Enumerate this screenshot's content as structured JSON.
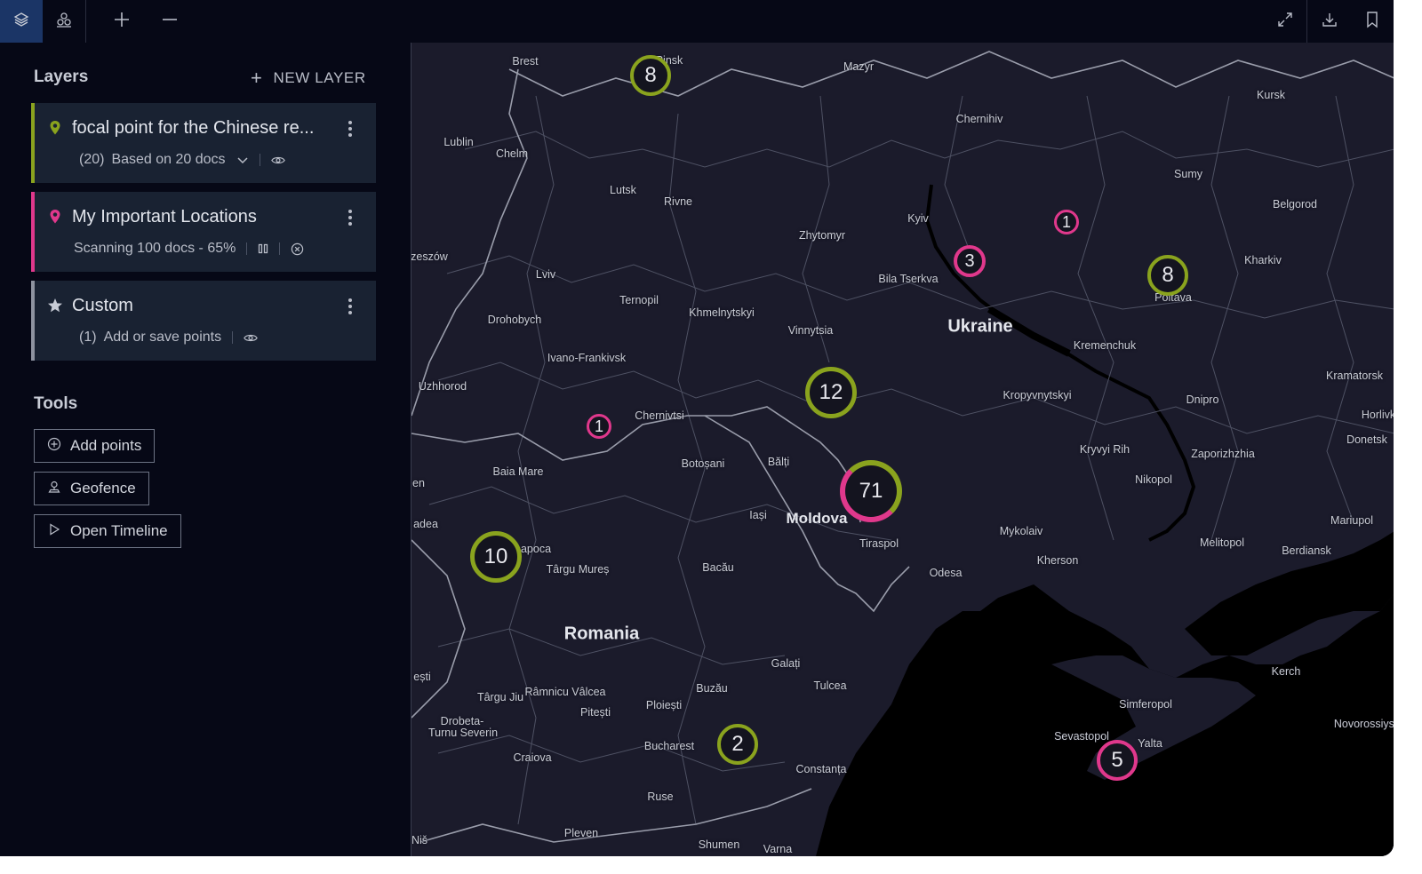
{
  "toolbar": {
    "buttons": [
      {
        "name": "layers-icon",
        "active": true
      },
      {
        "name": "cluster-icon",
        "active": false
      },
      {
        "name": "zoom-in-icon",
        "active": false
      },
      {
        "name": "zoom-out-icon",
        "active": false
      },
      {
        "name": "fullscreen-icon",
        "active": false
      },
      {
        "name": "download-icon",
        "active": false
      },
      {
        "name": "bookmark-icon",
        "active": false
      }
    ]
  },
  "sidebar": {
    "layers_title": "Layers",
    "new_layer_label": "NEW LAYER",
    "layers": [
      {
        "title": "focal point for the Chinese re...",
        "sub_count": "(20)",
        "sub_text": "Based on 20 docs",
        "icon": "map-pin-icon",
        "accent": "#8aa31e",
        "icon_color": "#8aa31e"
      },
      {
        "title": "My Important Locations",
        "sub_text": "Scanning 100 docs - 65%",
        "icon": "map-pin-icon",
        "accent": "#e0388c",
        "icon_color": "#e0388c"
      },
      {
        "title": "Custom",
        "sub_count": "(1)",
        "sub_text": "Add or save points",
        "icon": "star-icon",
        "accent": "#8e93a0",
        "icon_color": "#c8ccd6"
      }
    ],
    "tools_title": "Tools",
    "tools": [
      {
        "label": "Add points",
        "icon": "plus-circle-icon"
      },
      {
        "label": "Geofence",
        "icon": "geofence-icon"
      },
      {
        "label": "Open Timeline",
        "icon": "play-icon"
      }
    ]
  },
  "map": {
    "countries": [
      {
        "name": "Ukraine"
      },
      {
        "name": "Moldova"
      },
      {
        "name": "Romania"
      }
    ],
    "cities": [
      "Brest",
      "Pinsk",
      "Mazyr",
      "Kursk",
      "Lublin",
      "Chelm",
      "Chernihiv",
      "Sumy",
      "Lutsk",
      "Rivne",
      "Belgorod",
      "Zhytomyr",
      "Kyiv",
      "Kharkiv",
      "zeszów",
      "Bila Tserkva",
      "Poltava",
      "Lviv",
      "Ternopil",
      "Khmelnytskyi",
      "Drohobych",
      "Vinnytsia",
      "Kremenchuk",
      "Ivano-Frankivsk",
      "Kramatorsk",
      "Uzhhorod",
      "Kropyvnytskyi",
      "Dnipro",
      "Horlivk",
      "Chernivtsi",
      "Donetsk",
      "Kryvyi Rih",
      "Zaporizhzhia",
      "Botoșani",
      "Bălți",
      "Baia Mare",
      "Nikopol",
      "Iași",
      "en",
      "adea",
      "apoca",
      "Tiraspol",
      "Mykolaiv",
      "Mariupol",
      "Melitopol",
      "Berdiansk",
      "Târgu Mureș",
      "Bacău",
      "Kherson",
      "Odesa",
      "Galați",
      "ești",
      "Kerch",
      "Tulcea",
      "Târgu Jiu",
      "Râmnicu Vâlcea",
      "Buzău",
      "Simferopol",
      "Pitești",
      "Ploiești",
      "Drobeta-",
      "Turnu Severin",
      "Novorossiysk",
      "Sevastopol",
      "Yalta",
      "Bucharest",
      "Craiova",
      "Constanța",
      "Ruse",
      "Niš",
      "Pleven",
      "Shumen",
      "Varna"
    ],
    "clusters": [
      {
        "count": "8",
        "colors": [
          "#8aa31e"
        ]
      },
      {
        "count": "1",
        "colors": [
          "#e0388c"
        ]
      },
      {
        "count": "3",
        "colors": [
          "#e0388c"
        ]
      },
      {
        "count": "8",
        "colors": [
          "#8aa31e"
        ]
      },
      {
        "count": "12",
        "colors": [
          "#8aa31e"
        ]
      },
      {
        "count": "1",
        "colors": [
          "#e0388c"
        ]
      },
      {
        "count": "71",
        "colors": [
          "#8aa31e",
          "#e0388c"
        ]
      },
      {
        "count": "10",
        "colors": [
          "#8aa31e"
        ]
      },
      {
        "count": "2",
        "colors": [
          "#8aa31e"
        ]
      },
      {
        "count": "5",
        "colors": [
          "#e0388c"
        ]
      }
    ],
    "colors": {
      "land": "#1b1b2b",
      "sea": "#000000",
      "borders": "#8a8d9a"
    }
  }
}
